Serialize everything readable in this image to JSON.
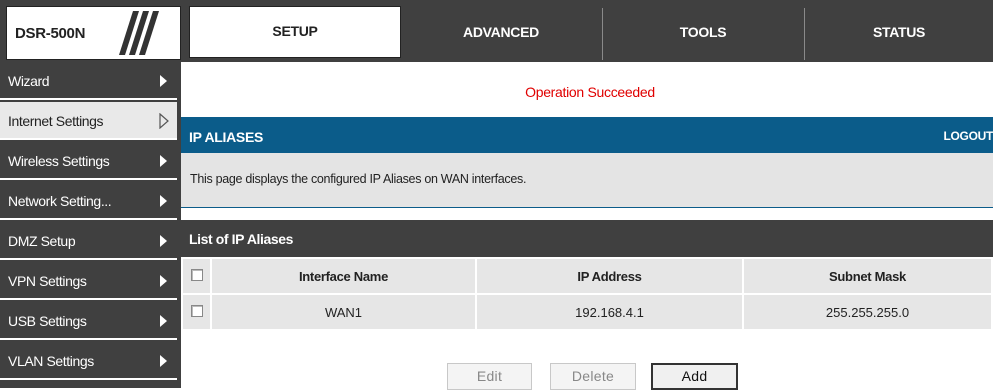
{
  "header": {
    "model": "DSR-500N",
    "tabs": [
      {
        "label": "SETUP",
        "active": true
      },
      {
        "label": "ADVANCED",
        "active": false
      },
      {
        "label": "TOOLS",
        "active": false
      },
      {
        "label": "STATUS",
        "active": false
      }
    ]
  },
  "sidebar": {
    "items": [
      {
        "label": "Wizard",
        "icon": "triangle-right-icon"
      },
      {
        "label": "Internet Settings",
        "icon": "triangle-right-outline-icon",
        "active": true
      },
      {
        "label": "Wireless Settings",
        "icon": "triangle-right-icon"
      },
      {
        "label": "Network Setting...",
        "icon": "triangle-right-icon"
      },
      {
        "label": "DMZ Setup",
        "icon": "triangle-right-icon"
      },
      {
        "label": "VPN Settings",
        "icon": "triangle-right-icon"
      },
      {
        "label": "USB Settings",
        "icon": "triangle-right-icon"
      },
      {
        "label": "VLAN Settings",
        "icon": "triangle-right-icon"
      }
    ]
  },
  "status_message": "Operation Succeeded",
  "panel": {
    "title": "IP ALIASES",
    "logout": "LOGOUT",
    "description": "This page displays the configured IP Aliases on WAN interfaces."
  },
  "list": {
    "title": "List of IP Aliases",
    "columns": [
      "Interface Name",
      "IP Address",
      "Subnet Mask"
    ],
    "rows": [
      {
        "interface": "WAN1",
        "ip": "192.168.4.1",
        "mask": "255.255.255.0"
      }
    ]
  },
  "buttons": {
    "edit": "Edit",
    "delete": "Delete",
    "add": "Add"
  },
  "colors": {
    "panel_header": "#0b5c8a",
    "dark_bar": "#404040",
    "status_text": "#e00000"
  }
}
